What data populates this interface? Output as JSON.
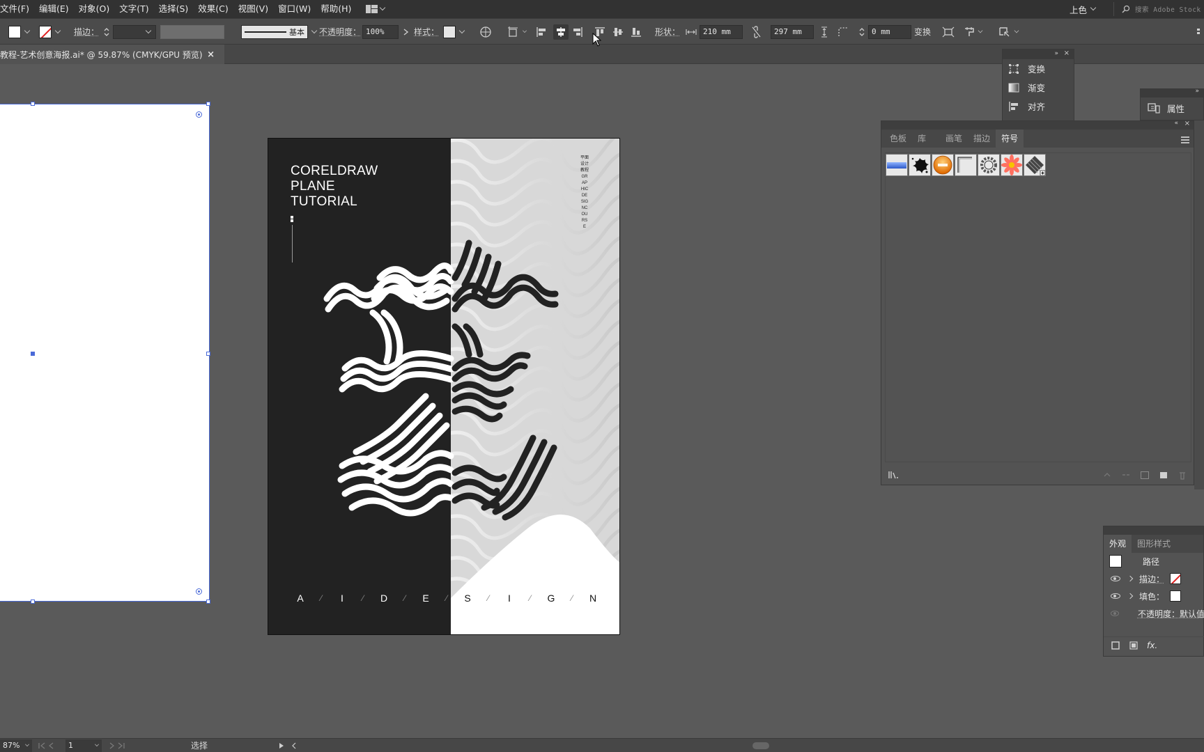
{
  "menubar": {
    "items": [
      "文件(F)",
      "编辑(E)",
      "对象(O)",
      "文字(T)",
      "选择(S)",
      "效果(C)",
      "视图(V)",
      "窗口(W)",
      "帮助(H)"
    ],
    "workspace": "上色",
    "stock_search_placeholder": "搜索 Adobe Stock"
  },
  "controlbar": {
    "stroke_label": "描边：",
    "stroke_profile": "基本",
    "opacity_label": "不透明度：",
    "opacity_value": "100%",
    "style_label": "样式：",
    "shape_label": "形状：",
    "width_value": "210 mm",
    "height_value": "297 mm",
    "corner_value": "0 mm",
    "transform_label": "变换"
  },
  "document": {
    "tab_title": "教程-艺术创意海报.ai* @ 59.87% (CMYK/GPU 预览)",
    "close": "×"
  },
  "poster": {
    "title_lines": [
      "CORELDRAW",
      "PLANE",
      "TUTORIAL"
    ],
    "vertical_text": "平面设计教程GRAPHICDESIGNCOURSE",
    "bottom_letters": [
      "A",
      "I",
      "D",
      "E",
      "S",
      "I",
      "G",
      "N"
    ],
    "colors": {
      "dark": "#222222",
      "light": "#d8d8d8",
      "artboard_selection": "#4a6ad8"
    }
  },
  "panel_mini": {
    "items": [
      {
        "label": "变换",
        "icon": "transform-icon"
      },
      {
        "label": "渐变",
        "icon": "gradient-icon"
      },
      {
        "label": "对齐",
        "icon": "align-icon"
      }
    ]
  },
  "panel_props": {
    "label": "属性",
    "icon": "properties-icon"
  },
  "panel_symbols": {
    "tabs": [
      "色板",
      "库",
      "画笔",
      "描边",
      "符号"
    ],
    "active_tab": "符号",
    "symbols": [
      "blue-bar-symbol",
      "ink-splat-symbol",
      "orange-button-symbol",
      "corner-frame-symbol",
      "ring-symbol",
      "flower-symbol",
      "diamond-pattern-symbol"
    ]
  },
  "panel_appearance": {
    "tabs": [
      "外观",
      "图形样式"
    ],
    "active_tab": "外观",
    "object_type": "路径",
    "stroke_label": "描边：",
    "fill_label": "填色：",
    "opacity_row": "不透明度：默认值",
    "fx_label": "fx."
  },
  "statusbar": {
    "zoom": "87%",
    "page": "1",
    "tool": "选择"
  }
}
